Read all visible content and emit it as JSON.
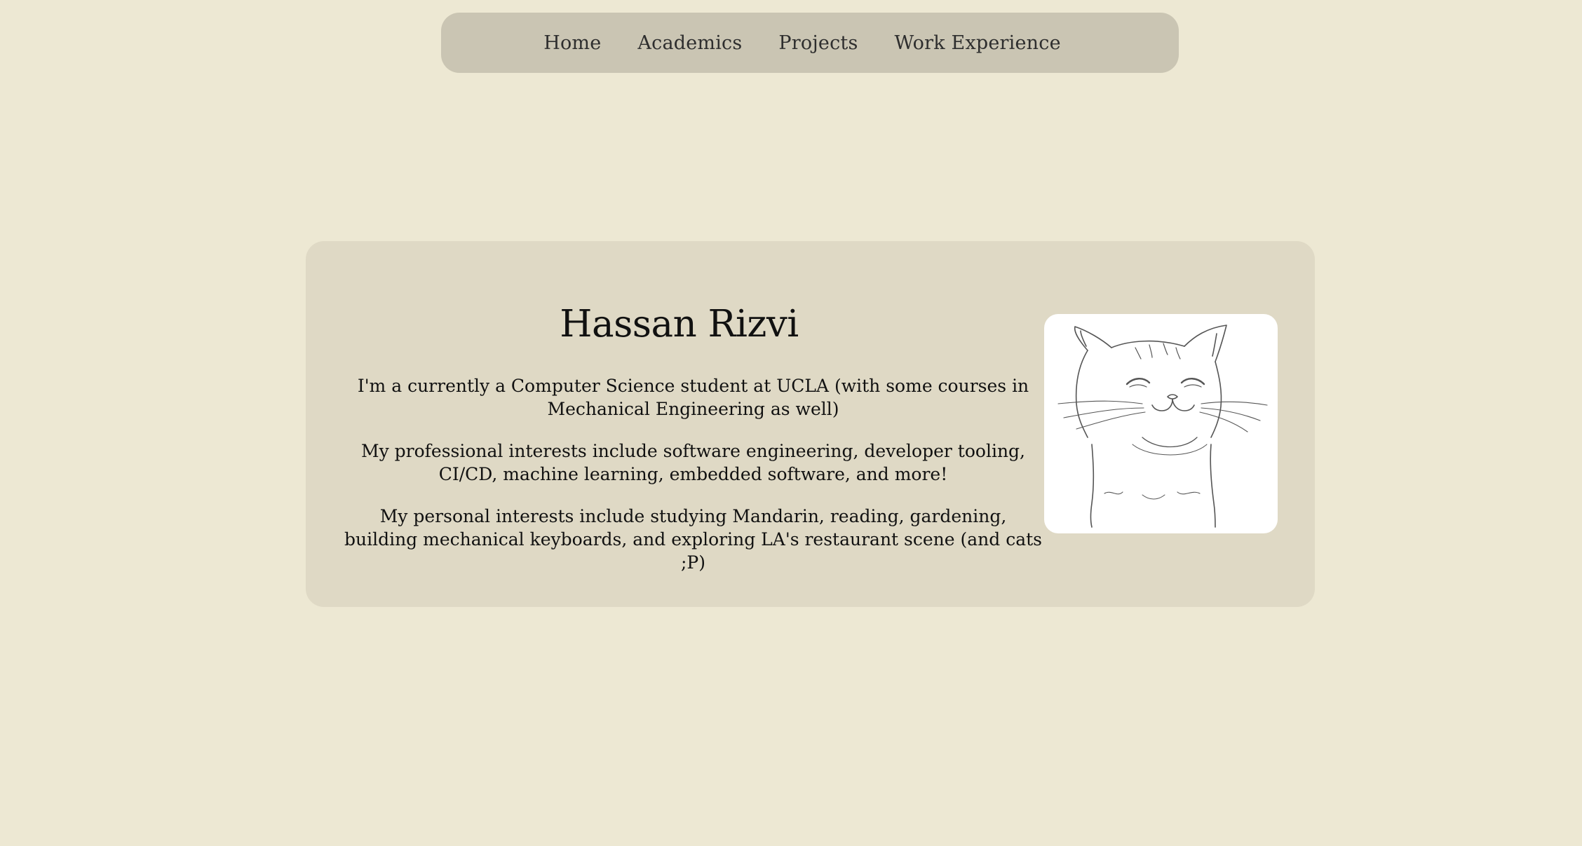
{
  "nav": {
    "items": [
      {
        "label": "Home"
      },
      {
        "label": "Academics"
      },
      {
        "label": "Projects"
      },
      {
        "label": "Work Experience"
      }
    ]
  },
  "profile": {
    "name": "Hassan Rizvi",
    "paragraphs": [
      "I'm a currently a Computer Science student at UCLA (with some courses in Mechanical Engineering as well)",
      "My professional interests include software engineering, developer tooling, CI/CD, machine learning, embedded software, and more!",
      "My personal interests include studying Mandarin, reading, gardening, building mechanical keyboards, and exploring LA's restaurant scene (and cats ;P)"
    ],
    "image": {
      "icon": "smiling-cat-drawing"
    }
  },
  "colors": {
    "page_background": "#ede8d3",
    "nav_background": "#cac5b3",
    "card_background": "#dfd9c5",
    "text": "#111111"
  }
}
